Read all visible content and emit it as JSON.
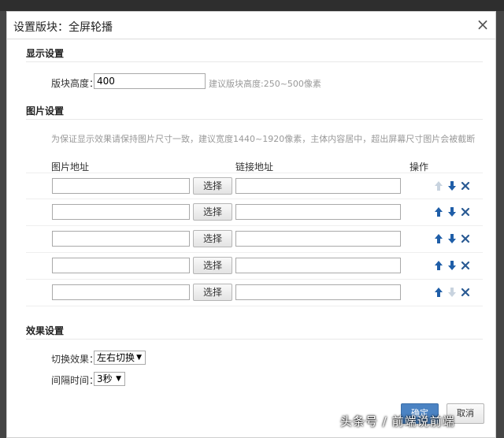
{
  "dialog": {
    "title": "设置版块：全屏轮播"
  },
  "display": {
    "section_title": "显示设置",
    "height_label": "版块高度：",
    "height_value": "400",
    "height_hint": "建议版块高度:250~500像素"
  },
  "images": {
    "section_title": "图片设置",
    "note": "为保证显示效果请保持图片尺寸一致，建议宽度1440~1920像素，主体内容居中，超出屏幕尺寸图片会被截断",
    "col_image": "图片地址",
    "col_link": "链接地址",
    "col_ops": "操作",
    "choose_label": "选择",
    "rows": [
      {
        "image": "",
        "link": "",
        "up_enabled": false,
        "down_enabled": true
      },
      {
        "image": "",
        "link": "",
        "up_enabled": true,
        "down_enabled": true
      },
      {
        "image": "",
        "link": "",
        "up_enabled": true,
        "down_enabled": true
      },
      {
        "image": "",
        "link": "",
        "up_enabled": true,
        "down_enabled": true
      },
      {
        "image": "",
        "link": "",
        "up_enabled": true,
        "down_enabled": false
      }
    ]
  },
  "effect": {
    "section_title": "效果设置",
    "switch_label": "切换效果：",
    "switch_value": "左右切换",
    "interval_label": "间隔时间：",
    "interval_value": "3秒"
  },
  "footer": {
    "ok_label": "确定",
    "cancel_label": "取消"
  },
  "watermark": "头条号 / 前端说前端",
  "colors": {
    "accent": "#4b83c3",
    "icon_active": "#1f5ea8",
    "icon_disabled": "#c8d3df",
    "delete": "#2a5a93"
  },
  "icons": {
    "up": "arrow-up-icon",
    "down": "arrow-down-icon",
    "delete": "delete-x-icon",
    "close": "close-icon"
  }
}
